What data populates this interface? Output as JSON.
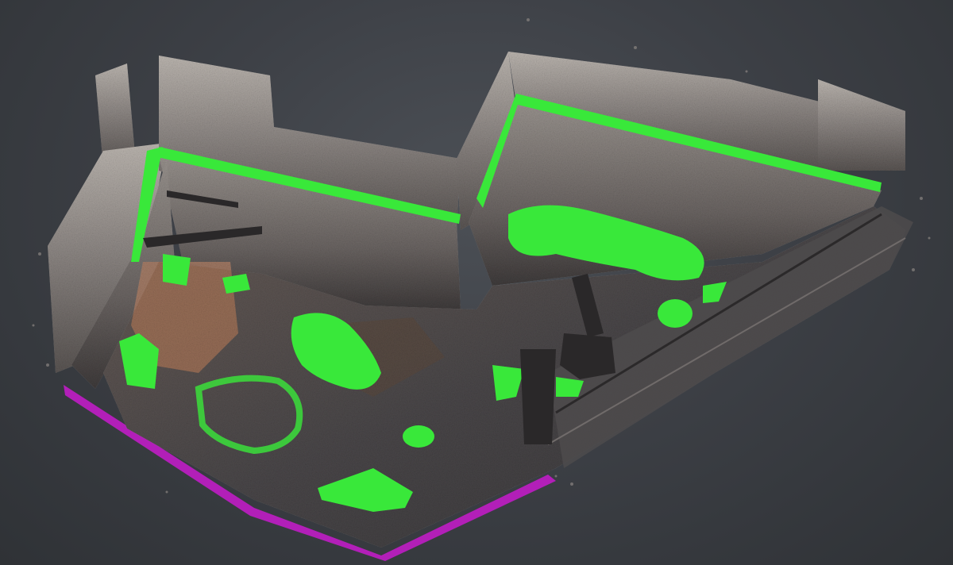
{
  "colors": {
    "background": "#3d4046",
    "wall_speckle_light": "#c9c3bd",
    "wall_speckle_mid": "#8f8985",
    "wall_speckle_dark": "#4a4645",
    "floor_dark": "#3a3839",
    "floor_mid": "#5a5658",
    "highlight_green": "#39e83a",
    "highlight_magenta": "#b21fb8",
    "dirt_orange": "#b07858"
  },
  "icons": [
    "point-cloud-scan"
  ]
}
